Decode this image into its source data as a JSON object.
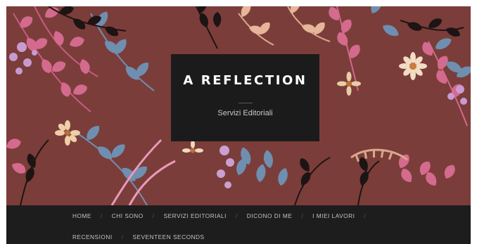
{
  "header": {
    "site_title": "A REFLECTION",
    "tagline": "Servizi Editoriali"
  },
  "nav": {
    "items": [
      {
        "label": "HOME"
      },
      {
        "label": "CHI SONO"
      },
      {
        "label": "SERVIZI EDITORIALI"
      },
      {
        "label": "DICONO DI ME"
      },
      {
        "label": "I MIEI LAVORI"
      },
      {
        "label": "RECENSIONI"
      },
      {
        "label": "SEVENTEEN SECONDS"
      }
    ],
    "separator": "/"
  },
  "colors": {
    "hero_background": "#7b3d3a",
    "title_box": "#1c1b1b",
    "nav_background": "#1d1d1d"
  },
  "decoration": "botanical-floral-illustration"
}
